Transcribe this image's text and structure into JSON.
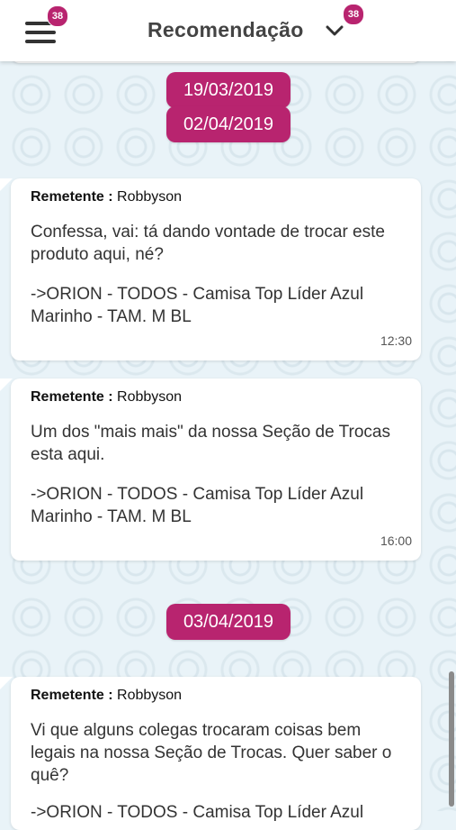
{
  "header": {
    "title": "Recomendação",
    "menu_badge": "38",
    "dropdown_badge": "38"
  },
  "dates": [
    "19/03/2019",
    "02/04/2019",
    "03/04/2019"
  ],
  "messages": [
    {
      "sender_label": "Remetente :",
      "sender": "Robbyson",
      "line1": "Confessa, vai: tá dando vontade de trocar este produto aqui, né?",
      "line2": "->ORION - TODOS - Camisa Top Líder Azul Marinho - TAM. M BL",
      "time": "12:30"
    },
    {
      "sender_label": "Remetente :",
      "sender": "Robbyson",
      "line1": "Um dos \"mais mais\" da nossa Seção de Trocas esta aqui.",
      "line2": "->ORION - TODOS - Camisa Top Líder Azul Marinho - TAM. M BL",
      "time": "16:00"
    },
    {
      "sender_label": "Remetente :",
      "sender": "Robbyson",
      "line1": "Vi que alguns colegas trocaram coisas bem legais na nossa Seção de Trocas. Quer saber o quê?",
      "line2": "->ORION - TODOS - Camisa Top Líder Azul"
    }
  ],
  "colors": {
    "accent": "#b8246f",
    "background": "#e9f3f8"
  },
  "icons": [
    "menu-icon",
    "chevron-down-icon"
  ]
}
